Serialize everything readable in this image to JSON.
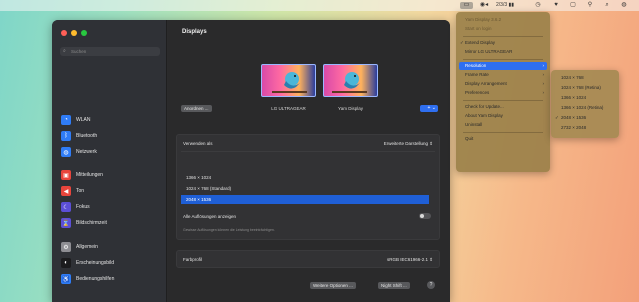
{
  "menubar": {
    "clock": "2/3/3 ▮▮",
    "icons": [
      "display-menu-icon",
      "record-icon",
      "clock-icon",
      "shield-icon",
      "battery-icon",
      "control-center-icon",
      "search-icon",
      "siri-icon"
    ]
  },
  "sidebar": {
    "search_placeholder": "Suchen",
    "items": [
      {
        "label": "WLAN",
        "icon": "wifi-icon",
        "color": "#2f7cf6",
        "glyph": "◔"
      },
      {
        "label": "Bluetooth",
        "icon": "bluetooth-icon",
        "color": "#2f7cf6",
        "glyph": "ᛒ"
      },
      {
        "label": "Netzwerk",
        "icon": "network-icon",
        "color": "#2f7cf6",
        "glyph": "◍"
      },
      {
        "label": "Mitteilungen",
        "icon": "notifications-icon",
        "color": "#e8453c",
        "glyph": "▣"
      },
      {
        "label": "Ton",
        "icon": "sound-icon",
        "color": "#e8453c",
        "glyph": "◀"
      },
      {
        "label": "Fokus",
        "icon": "focus-icon",
        "color": "#5c4fd6",
        "glyph": "☾"
      },
      {
        "label": "Bildschirmzeit",
        "icon": "screen-time-icon",
        "color": "#5c4fd6",
        "glyph": "⌛"
      },
      {
        "label": "Allgemein",
        "icon": "general-icon",
        "color": "#8e8e93",
        "glyph": "⚙"
      },
      {
        "label": "Erscheinungsbild",
        "icon": "appearance-icon",
        "color": "#1c1c1e",
        "glyph": "◐"
      },
      {
        "label": "Bedienungshilfen",
        "icon": "accessibility-icon",
        "color": "#2f7cf6",
        "glyph": "♿"
      }
    ]
  },
  "main": {
    "title": "Displays",
    "arrange_button": "Anordnen ...",
    "displays": [
      {
        "name": "LG ULTRAGEAR"
      },
      {
        "name": "Yam Display"
      }
    ],
    "add_button": "+ ⌄",
    "use_as_label": "Verwenden als",
    "use_as_value": "Erweiterte Darstellung ⇕",
    "resolutions": [
      "1366 × 1024",
      "1024 × 768 (Standard)",
      "2048 × 1536"
    ],
    "selected_resolution_index": 2,
    "show_all_label": "Alle Auflösungen anzeigen",
    "hint_text": "Gewisse Auflösungen können die Leistung beeinträchtigen.",
    "color_profile_label": "Farbprofil",
    "color_profile_value": "sRGB IEC61966-2.1 ⇕",
    "advanced_button": "Weitere Optionen ...",
    "night_shift_button": "Night Shift ...",
    "help_label": "?"
  },
  "menu": {
    "items": [
      {
        "label": "Yam Display 3.6.2",
        "kind": "dim"
      },
      {
        "label": "Start on login",
        "kind": "dim"
      },
      {
        "kind": "sep"
      },
      {
        "label": "Extend Display",
        "kind": "check"
      },
      {
        "label": "Mirror LG ULTRAGEAR",
        "kind": "normal"
      },
      {
        "kind": "sep"
      },
      {
        "label": "Resolution",
        "kind": "highlight",
        "arrow": "›"
      },
      {
        "label": "Frame Rate",
        "kind": "normal",
        "arrow": "›"
      },
      {
        "label": "Display Arrangement",
        "kind": "normal",
        "arrow": "›"
      },
      {
        "label": "Preferences",
        "kind": "normal",
        "arrow": "›"
      },
      {
        "kind": "sep"
      },
      {
        "label": "Check for Update...",
        "kind": "normal"
      },
      {
        "label": "About Yam Display",
        "kind": "normal"
      },
      {
        "label": "Uninstall",
        "kind": "normal"
      },
      {
        "kind": "sep"
      },
      {
        "label": "Quit",
        "kind": "normal"
      }
    ],
    "check_glyph": "✓"
  },
  "submenu": {
    "items": [
      {
        "label": "1024 × 768",
        "checked": false
      },
      {
        "label": "1024 × 768 (Retina)",
        "checked": false
      },
      {
        "label": "1366 × 1024",
        "checked": false
      },
      {
        "label": "1366 × 1024 (Retina)",
        "checked": false
      },
      {
        "label": "2048 × 1536",
        "checked": true
      },
      {
        "label": "2732 × 2048",
        "checked": false
      }
    ],
    "check_glyph": "✓"
  }
}
